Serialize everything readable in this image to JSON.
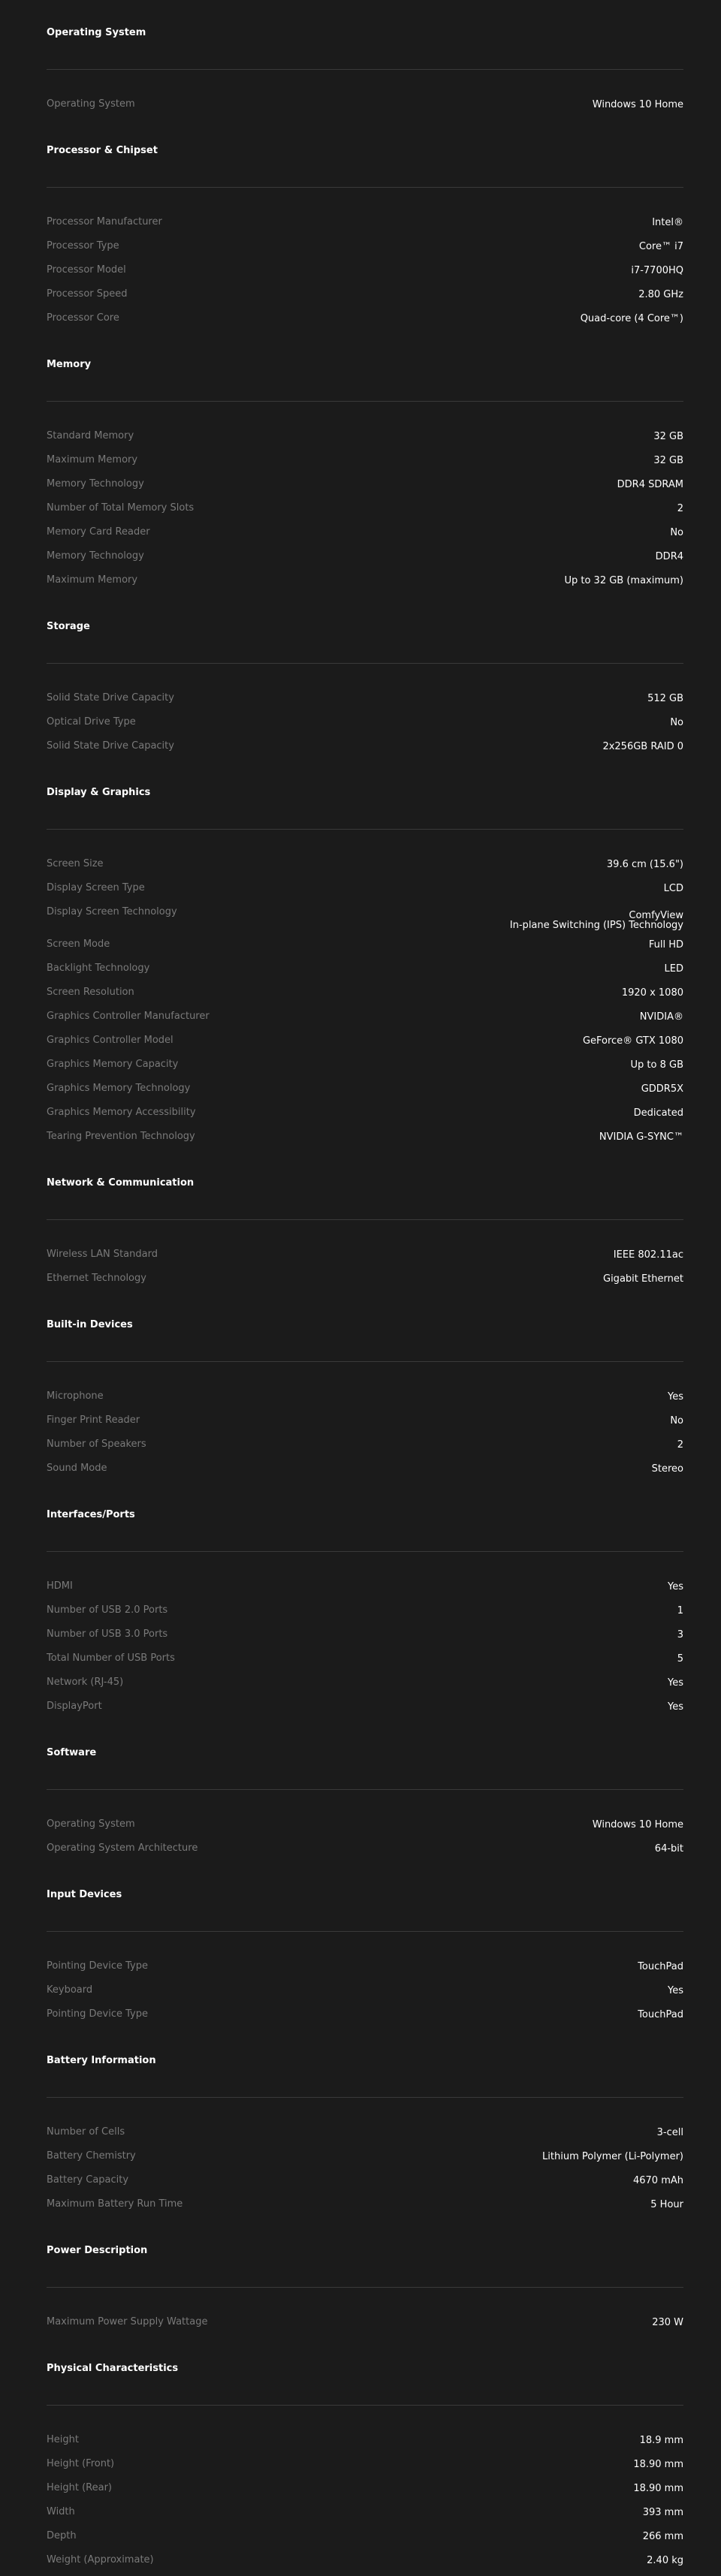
{
  "sections": [
    {
      "title": "Operating System",
      "rows": [
        {
          "label": "Operating System",
          "value": "Windows 10 Home"
        }
      ]
    },
    {
      "title": "Processor & Chipset",
      "rows": [
        {
          "label": "Processor Manufacturer",
          "value": "Intel®"
        },
        {
          "label": "Processor Type",
          "value": "Core™ i7"
        },
        {
          "label": "Processor Model",
          "value": "i7-7700HQ"
        },
        {
          "label": "Processor Speed",
          "value": "2.80 GHz"
        },
        {
          "label": "Processor Core",
          "value": "Quad-core (4 Core™)"
        }
      ]
    },
    {
      "title": "Memory",
      "rows": [
        {
          "label": "Standard Memory",
          "value": "32 GB"
        },
        {
          "label": "Maximum Memory",
          "value": "32 GB"
        },
        {
          "label": "Memory Technology",
          "value": "DDR4 SDRAM"
        },
        {
          "label": "Number of Total Memory Slots",
          "value": "2"
        },
        {
          "label": "Memory Card Reader",
          "value": "No"
        },
        {
          "label": "Memory Technology",
          "value": "DDR4"
        },
        {
          "label": "Maximum Memory",
          "value": "Up to 32 GB (maximum)"
        }
      ]
    },
    {
      "title": "Storage",
      "rows": [
        {
          "label": "Solid State Drive Capacity",
          "value": "512 GB"
        },
        {
          "label": "Optical Drive Type",
          "value": "No"
        },
        {
          "label": "Solid State Drive Capacity",
          "value": "2x256GB RAID 0"
        }
      ]
    },
    {
      "title": "Display & Graphics",
      "rows": [
        {
          "label": "Screen Size",
          "value": "39.6 cm (15.6\")"
        },
        {
          "label": "Display Screen Type",
          "value": "LCD"
        },
        {
          "label": "Display Screen Technology",
          "value": "ComfyView\nIn-plane Switching (IPS) Technology"
        },
        {
          "label": "Screen Mode",
          "value": "Full HD"
        },
        {
          "label": "Backlight Technology",
          "value": "LED"
        },
        {
          "label": "Screen Resolution",
          "value": "1920 x 1080"
        },
        {
          "label": "Graphics Controller Manufacturer",
          "value": "NVIDIA®"
        },
        {
          "label": "Graphics Controller Model",
          "value": "GeForce® GTX 1080"
        },
        {
          "label": "Graphics Memory Capacity",
          "value": "Up to 8 GB"
        },
        {
          "label": "Graphics Memory Technology",
          "value": "GDDR5X"
        },
        {
          "label": "Graphics Memory Accessibility",
          "value": "Dedicated"
        },
        {
          "label": "Tearing Prevention Technology",
          "value": "NVIDIA G-SYNC™"
        }
      ]
    },
    {
      "title": "Network & Communication",
      "rows": [
        {
          "label": "Wireless LAN Standard",
          "value": "IEEE 802.11ac"
        },
        {
          "label": "Ethernet Technology",
          "value": "Gigabit Ethernet"
        }
      ]
    },
    {
      "title": "Built-in Devices",
      "rows": [
        {
          "label": "Microphone",
          "value": "Yes"
        },
        {
          "label": "Finger Print Reader",
          "value": "No"
        },
        {
          "label": "Number of Speakers",
          "value": "2"
        },
        {
          "label": "Sound Mode",
          "value": "Stereo"
        }
      ]
    },
    {
      "title": "Interfaces/Ports",
      "rows": [
        {
          "label": "HDMI",
          "value": "Yes"
        },
        {
          "label": "Number of USB 2.0 Ports",
          "value": "1"
        },
        {
          "label": "Number of USB 3.0 Ports",
          "value": "3"
        },
        {
          "label": "Total Number of USB Ports",
          "value": "5"
        },
        {
          "label": "Network (RJ-45)",
          "value": "Yes"
        },
        {
          "label": "DisplayPort",
          "value": "Yes"
        }
      ]
    },
    {
      "title": "Software",
      "rows": [
        {
          "label": "Operating System",
          "value": "Windows 10 Home"
        },
        {
          "label": "Operating System Architecture",
          "value": "64-bit"
        }
      ]
    },
    {
      "title": "Input Devices",
      "rows": [
        {
          "label": "Pointing Device Type",
          "value": "TouchPad"
        },
        {
          "label": "Keyboard",
          "value": "Yes"
        },
        {
          "label": "Pointing Device Type",
          "value": "TouchPad"
        }
      ]
    },
    {
      "title": "Battery Information",
      "rows": [
        {
          "label": "Number of Cells",
          "value": "3-cell"
        },
        {
          "label": "Battery Chemistry",
          "value": "Lithium Polymer (Li-Polymer)"
        },
        {
          "label": "Battery Capacity",
          "value": "4670 mAh"
        },
        {
          "label": "Maximum Battery Run Time",
          "value": "5 Hour"
        }
      ]
    },
    {
      "title": "Power Description",
      "rows": [
        {
          "label": "Maximum Power Supply Wattage",
          "value": "230 W"
        }
      ]
    },
    {
      "title": "Physical Characteristics",
      "rows": [
        {
          "label": "Height",
          "value": "18.9 mm"
        },
        {
          "label": "Height (Front)",
          "value": "18.90 mm"
        },
        {
          "label": "Height (Rear)",
          "value": "18.90 mm"
        },
        {
          "label": "Width",
          "value": "393 mm"
        },
        {
          "label": "Depth",
          "value": "266 mm"
        },
        {
          "label": "Weight (Approximate)",
          "value": "2.40 kg"
        }
      ]
    }
  ]
}
